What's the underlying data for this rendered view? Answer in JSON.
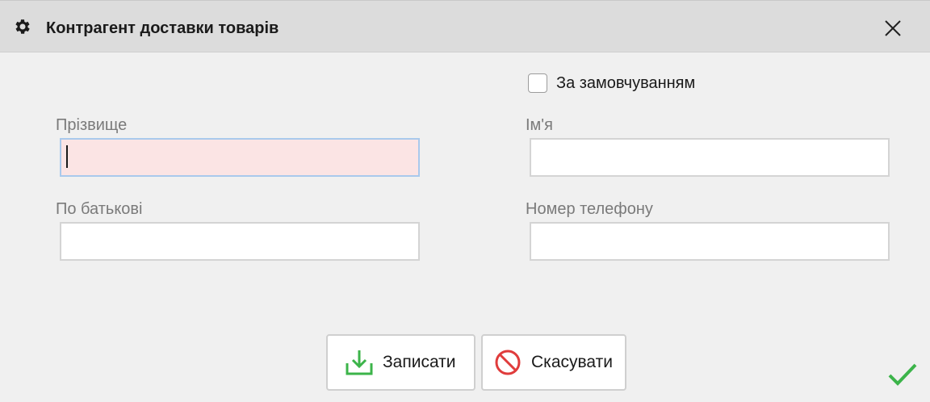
{
  "window": {
    "title": "Контрагент доставки товарів",
    "title_icon": "gear-icon",
    "close_icon": "close-icon"
  },
  "default_checkbox": {
    "label": "За замовчуванням",
    "checked": false
  },
  "form": {
    "surname": {
      "label": "Прізвище",
      "value": "",
      "required": true,
      "focused": true
    },
    "first_name": {
      "label": "Ім'я",
      "value": ""
    },
    "patronymic": {
      "label": "По батькові",
      "value": ""
    },
    "phone": {
      "label": "Номер телефону",
      "value": ""
    }
  },
  "buttons": {
    "save": {
      "label": "Записати",
      "icon": "save-download-icon"
    },
    "cancel": {
      "label": "Скасувати",
      "icon": "cancel-icon"
    }
  },
  "status": {
    "ok_icon": "checkmark-icon"
  },
  "colors": {
    "titlebar": "#dcdcdc",
    "required_field_bg": "#fbe4e4",
    "focus_border": "#a9c9ec",
    "save_icon": "#3cb44a",
    "cancel_icon": "#e03c3c",
    "ok_check": "#3cb44a"
  }
}
